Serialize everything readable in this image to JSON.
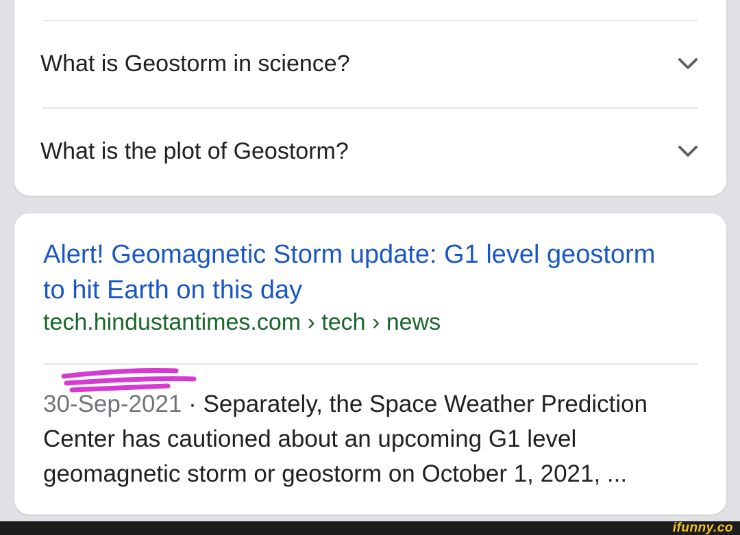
{
  "faq": {
    "items": [
      {
        "question": "What is Geostorm in science?"
      },
      {
        "question": "What is the plot of Geostorm?"
      }
    ]
  },
  "result": {
    "title": "Alert! Geomagnetic Storm update: G1 level geostorm to hit Earth on this day",
    "breadcrumb": "tech.hindustantimes.com › tech › news",
    "date": "30-Sep-2021",
    "separator": " · ",
    "snippet": "Separately, the Space Weather Prediction Center has cautioned about an upcoming G1 level geomagnetic storm or geostorm on October 1, 2021, ..."
  },
  "footer": {
    "watermark": "ifunny.co"
  },
  "colors": {
    "link": "#1a57c6",
    "url": "#18662b",
    "scribble": "#d63ad1",
    "watermark": "#f7c51e"
  },
  "icons": [
    "chevron-down-icon",
    "scribble-mark"
  ]
}
